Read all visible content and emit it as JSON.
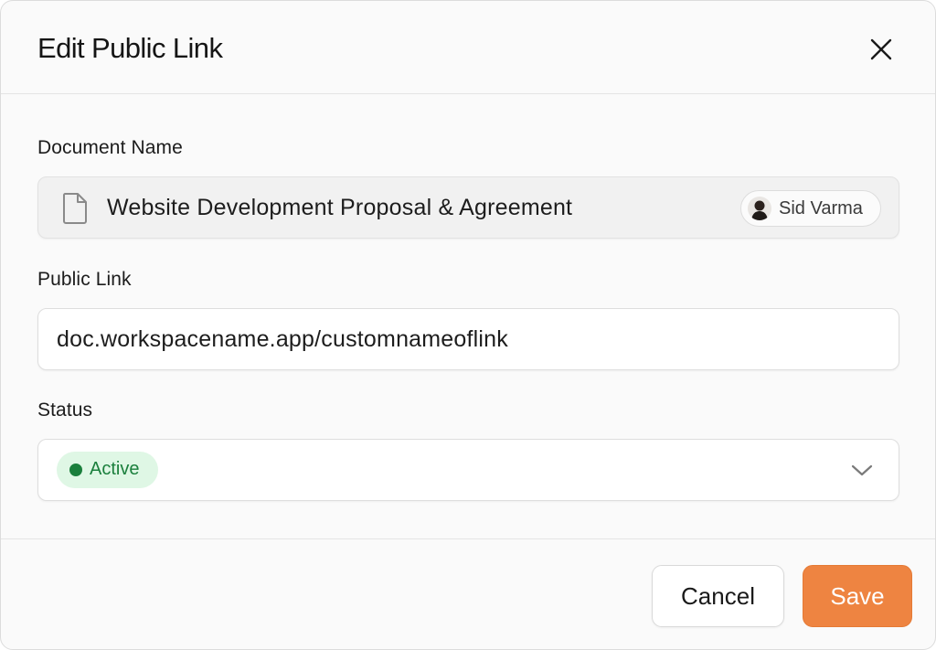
{
  "dialog": {
    "title": "Edit Public Link",
    "close_icon": "close-icon"
  },
  "document": {
    "label": "Document Name",
    "icon": "document-icon",
    "name": "Website Development Proposal & Agreement",
    "owner": {
      "name": "Sid Varma",
      "avatar": "avatar"
    }
  },
  "public_link": {
    "label": "Public Link",
    "value": "doc.workspacename.app/customnameoflink"
  },
  "status": {
    "label": "Status",
    "selected": "Active",
    "indicator_color": "#1a7f3c",
    "pill_color": "#dff7e5",
    "dropdown_icon": "chevron-down-icon"
  },
  "footer": {
    "cancel_label": "Cancel",
    "save_label": "Save",
    "save_color": "#ee8441"
  }
}
